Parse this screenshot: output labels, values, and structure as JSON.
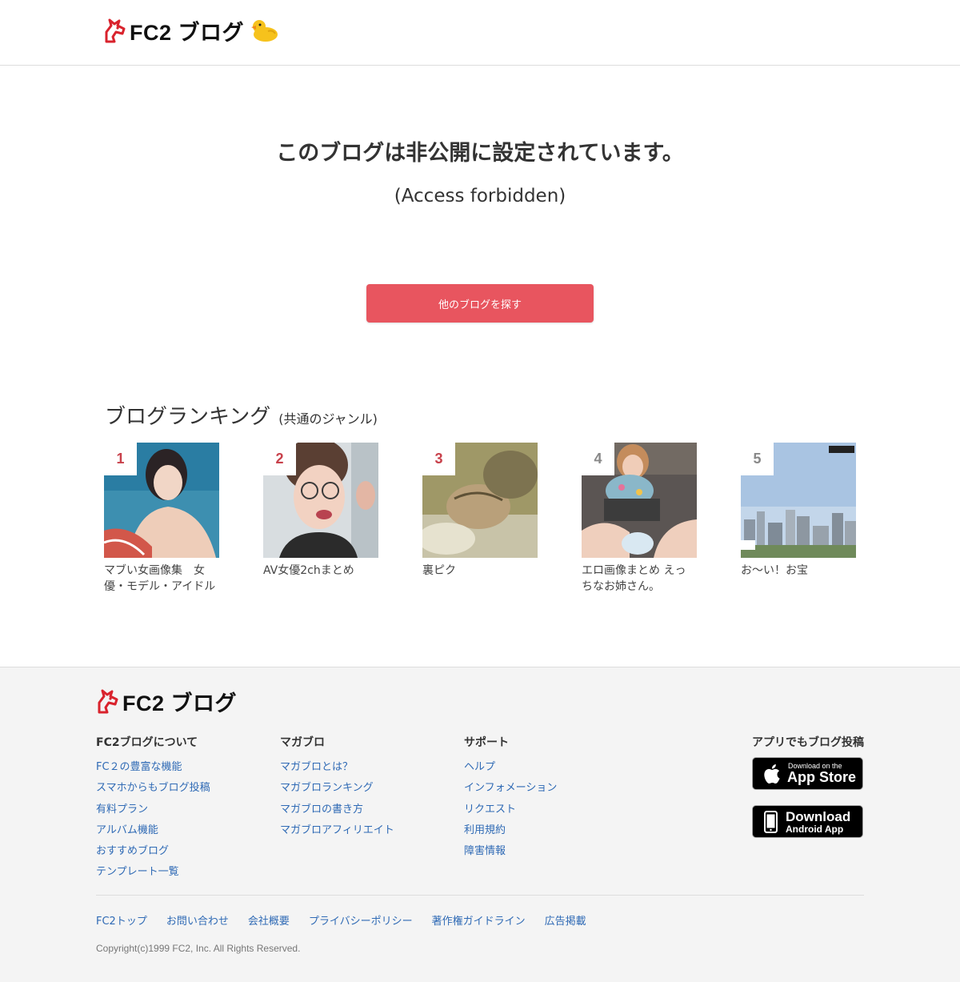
{
  "header": {
    "logo_text": "FC2",
    "logo_suffix": "ブログ"
  },
  "message": {
    "title": "このブログは非公開に設定されています。",
    "subtitle": "(Access forbidden)"
  },
  "find_button": {
    "label": "他のブログを探す",
    "color": "#e8555f"
  },
  "ranking": {
    "title": "ブログランキング",
    "subtitle": "(共通のジャンル)",
    "items": [
      {
        "rank": "1",
        "name": "マブい女画像集　女優・モデル・アイドル"
      },
      {
        "rank": "2",
        "name": "AV女優2chまとめ"
      },
      {
        "rank": "3",
        "name": "裏ピク"
      },
      {
        "rank": "4",
        "name": "エロ画像まとめ えっちなお姉さん。"
      },
      {
        "rank": "5",
        "name": "お〜い！お宝"
      }
    ]
  },
  "footer": {
    "logo_text": "FC2",
    "logo_suffix": "ブログ",
    "columns": [
      {
        "heading": "FC2ブログについて",
        "links": [
          "FC２の豊富な機能",
          "スマホからもブログ投稿",
          "有料プラン",
          "アルバム機能",
          "おすすめブログ",
          "テンプレート一覧"
        ]
      },
      {
        "heading": "マガブロ",
        "links": [
          "マガブロとは？",
          "マガブロランキング",
          "マガブロの書き方",
          "マガブロアフィリエイト"
        ]
      },
      {
        "heading": "サポート",
        "links": [
          "ヘルプ",
          "インフォメーション",
          "リクエスト",
          "利用規約",
          "障害情報"
        ]
      }
    ],
    "apps": {
      "heading": "アプリでもブログ投稿",
      "appstore_small": "Download on the",
      "appstore_big": "App Store",
      "android_big": "Download",
      "android_small": "Android App"
    },
    "bottom_links": [
      "FC2トップ",
      "お問い合わせ",
      "会社概要",
      "プライバシーポリシー",
      "著作権ガイドライン",
      "広告掲載"
    ],
    "copyright": "Copyright(c)1999 FC2, Inc. All Rights Reserved.",
    "link_color": "#2f6ab5"
  }
}
